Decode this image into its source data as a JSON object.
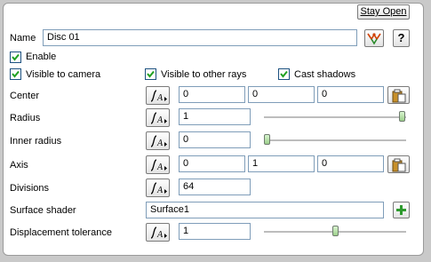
{
  "header": {
    "stay_open_label": "Stay Open"
  },
  "name": {
    "label": "Name",
    "value": "Disc 01",
    "help_label": "?"
  },
  "checkboxes": {
    "enable": {
      "label": "Enable",
      "checked": true
    },
    "visible_to_camera": {
      "label": "Visible to camera",
      "checked": true
    },
    "visible_to_other_rays": {
      "label": "Visible to other rays",
      "checked": true
    },
    "cast_shadows": {
      "label": "Cast shadows",
      "checked": true
    }
  },
  "center": {
    "label": "Center",
    "x": "0",
    "y": "0",
    "z": "0"
  },
  "radius": {
    "label": "Radius",
    "value": "1",
    "slider_position": 1.0
  },
  "inner_radius": {
    "label": "Inner radius",
    "value": "0",
    "slider_position": 0.0
  },
  "axis": {
    "label": "Axis",
    "x": "0",
    "y": "1",
    "z": "0"
  },
  "divisions": {
    "label": "Divisions",
    "value": "64"
  },
  "surface_shader": {
    "label": "Surface shader",
    "value": "Surface1"
  },
  "displacement_tolerance": {
    "label": "Displacement tolerance",
    "value": "1",
    "slider_position": 0.5
  },
  "colors": {
    "field_border": "#7f9db9",
    "checkbox_mark": "#21a121",
    "slider_thumb": "#9ccf8a",
    "add_button": "#2e9a2e"
  },
  "icons": {
    "curve": "curve-editor-icon",
    "paste": "clipboard-paste-icon",
    "pick": "node-picker-icon",
    "add": "plus-icon"
  }
}
